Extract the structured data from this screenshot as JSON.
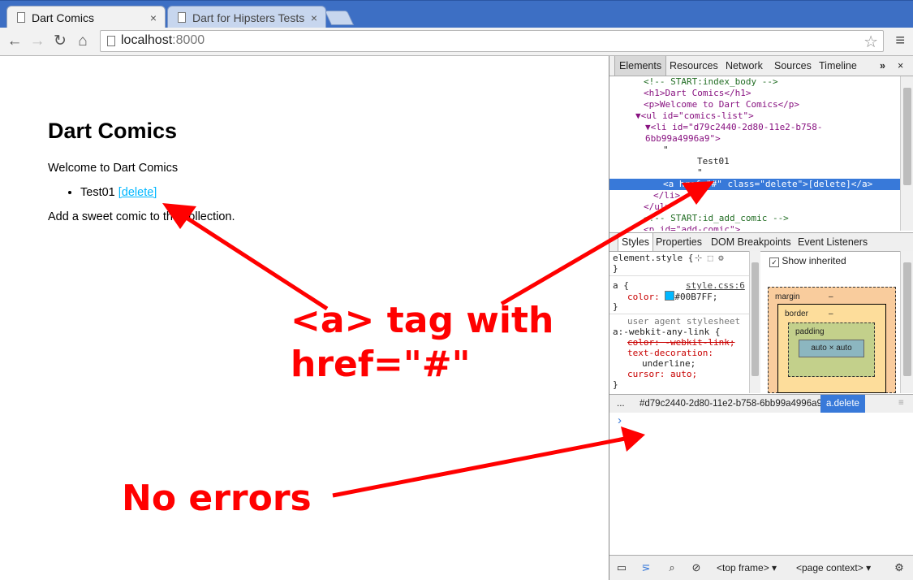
{
  "browser": {
    "tabs": [
      {
        "title": "Dart Comics",
        "close": "×"
      },
      {
        "title": "Dart for Hipsters Tests",
        "close": "×"
      }
    ],
    "url_host": "localhost",
    "url_port": ":8000",
    "icons": {
      "back": "arrow-left-icon",
      "forward": "arrow-right-icon",
      "reload": "reload-icon",
      "home": "home-icon",
      "star": "star-icon",
      "menu": "menu-icon"
    }
  },
  "page": {
    "heading": "Dart Comics",
    "welcome": "Welcome to Dart Comics",
    "item_text": "Test01",
    "delete_link": "[delete]",
    "add_text": "Add a sweet comic to the collection."
  },
  "devtools": {
    "tabs": [
      "Elements",
      "Resources",
      "Network",
      "Sources",
      "Timeline"
    ],
    "more": "»",
    "close": "×",
    "dom_lines": [
      "<!-- START:index_body -->",
      "<h1>Dart Comics</h1>",
      "<p>Welcome to Dart Comics</p>",
      "▼<ul id=\"comics-list\">",
      "▼<li id=\"d79c2440-2d80-11e2-b758-",
      "6bb99a4996a9\">",
      "\"",
      "Test01",
      "\"",
      "<a href=\"#\" class=\"delete\">[delete]</a>",
      "</li>",
      "</ul>",
      "<!-- START:id_add_comic -->",
      "<p id=\"add-comic\">"
    ],
    "sub_tabs": [
      "Styles",
      "Properties",
      "DOM Breakpoints",
      "Event Listeners"
    ],
    "styles": {
      "element_style": "element.style {",
      "close_brace": "}",
      "rule_selector": "a {",
      "rule_source": "style.css:6",
      "color_prop": "color:",
      "color_value": "#00B7FF;",
      "ua_label": "user agent stylesheet",
      "ua_selector": "a:-webkit-any-link {",
      "ua_color": "color: -webkit-link;",
      "ua_textdeco": "text-decoration:",
      "ua_underline": "underline;",
      "ua_cursor": "cursor: auto;"
    },
    "show_inherited": "Show inherited",
    "metrics": {
      "margin": "margin",
      "border": "border",
      "padding": "padding",
      "content": "auto × auto",
      "dash": "–"
    },
    "breadcrumbs": [
      "...",
      "#d79c2440-2d80-11e2-b758-6bb99a4996a9",
      "a.delete"
    ],
    "console_prompt": "›",
    "frame_select": "<top frame>",
    "context_select": "<page context>"
  },
  "annotations": {
    "a_tag": "<a> tag with\nhref=\"#\"",
    "no_errors": "No errors"
  },
  "colors": {
    "annotation": "#ff0000",
    "link": "#00B7FF",
    "selection": "#3879d9"
  }
}
